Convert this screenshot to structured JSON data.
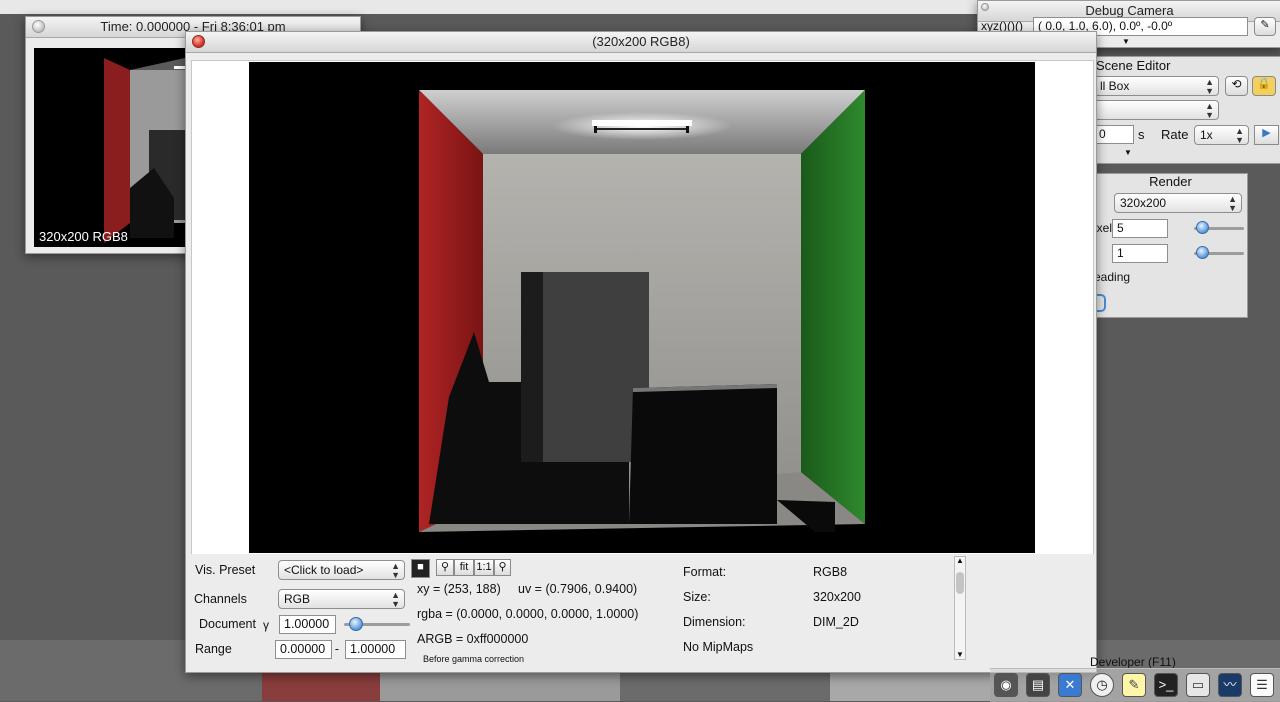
{
  "preview_window": {
    "title": "Time: 0.000000 - Fri 8:36:01 pm",
    "overlay_label": "320x200 RGB8"
  },
  "camera_window": {
    "title": "Debug Camera",
    "xyz_label": "xyz()()()",
    "xyz_value": "( 0.0, 1.0, 6.0), 0.0º, -0.0º"
  },
  "scene_editor": {
    "title": "Scene Editor",
    "scene_value": "ll Box",
    "secondary_value": "",
    "time_unit": "s",
    "time_value": "0",
    "rate_label": "Rate",
    "rate_value": "1x"
  },
  "render_window": {
    "title": "Render",
    "resolution_value": "320x200",
    "pixel_label": "ixel",
    "pixel_value": "5",
    "row2_value": "1",
    "shading_label": "eading"
  },
  "main_window": {
    "title": "(320x200 RGB8)",
    "vis_preset_label": "Vis. Preset",
    "vis_preset_value": "<Click to load>",
    "channels_label": "Channels",
    "channels_value": "RGB",
    "document_label": "Document",
    "gamma_symbol": "γ",
    "gamma_value": "1.00000",
    "range_label": "Range",
    "range_min": "0.00000",
    "range_sep": "-",
    "range_max": "1.00000",
    "zoom_fit_label": "fit",
    "zoom_one_label": "1:1",
    "xy_text": "xy = (253, 188)",
    "uv_text": "uv = (0.7906, 0.9400)",
    "rgba_text": "rgba = (0.0000, 0.0000, 0.0000, 1.0000)",
    "argb_text": "ARGB = 0xff000000",
    "gamma_note": "Before gamma correction",
    "format_label": "Format:",
    "format_value": "RGB8",
    "size_label": "Size:",
    "size_value": "320x200",
    "dimension_label": "Dimension:",
    "dimension_value": "DIM_2D",
    "mipmaps_text": "No MipMaps"
  },
  "developer_label": "Developer (F11)",
  "dock_icons": [
    "camera-icon",
    "film-icon",
    "tools-icon",
    "clock-icon",
    "notes-icon",
    "terminal-icon",
    "window-icon",
    "monitor-icon",
    "document-icon"
  ]
}
